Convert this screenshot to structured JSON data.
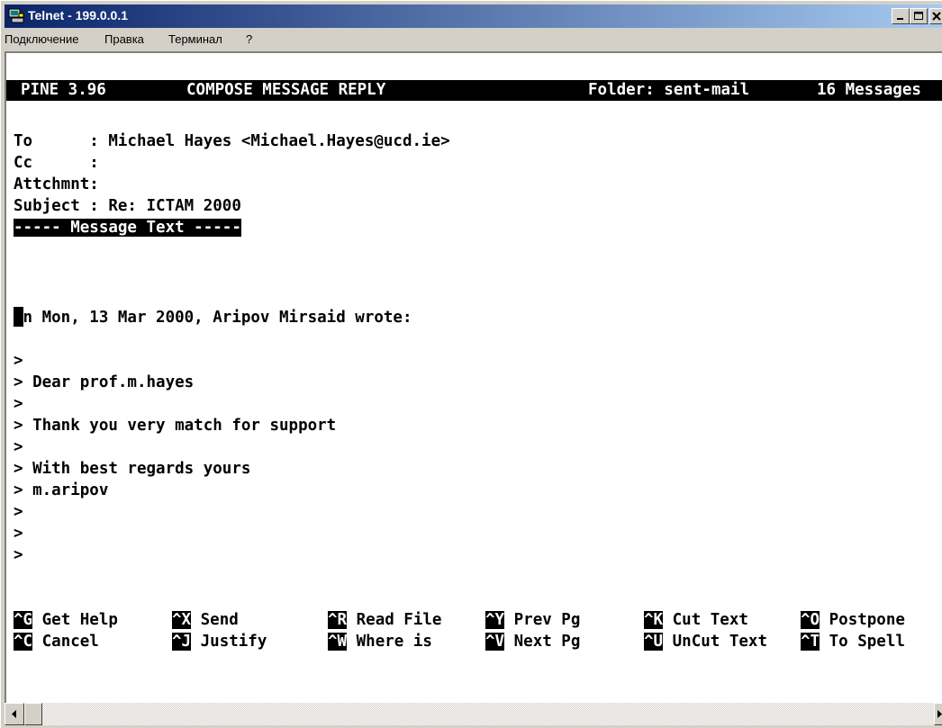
{
  "window": {
    "title": "Telnet - 199.0.0.1",
    "controls": [
      "minimize",
      "maximize",
      "close"
    ]
  },
  "menu": {
    "items": [
      "Подключение",
      "Правка",
      "Терминал",
      "?"
    ]
  },
  "status": {
    "program": "PINE 3.96",
    "mode": "COMPOSE MESSAGE REPLY",
    "folder": "Folder: sent-mail",
    "messages": "16 Messages"
  },
  "headers": [
    "To      : Michael Hayes <Michael.Hayes@ucd.ie>",
    "Cc      :",
    "Attchmnt:",
    "Subject : Re: ICTAM 2000"
  ],
  "separator": "----- Message Text -----",
  "body": {
    "attribution": "On Mon, 13 Mar 2000, Aripov Mirsaid wrote:",
    "quoted": [
      ">",
      "> Dear prof.m.hayes",
      ">",
      "> Thank you very match for support",
      ">",
      "> With best regards yours",
      "> m.aripov",
      ">",
      ">",
      ">"
    ]
  },
  "shortcuts": [
    [
      {
        "key": "^G",
        "label": "Get Help"
      },
      {
        "key": "^X",
        "label": "Send"
      },
      {
        "key": "^R",
        "label": "Read File"
      },
      {
        "key": "^Y",
        "label": "Prev Pg"
      },
      {
        "key": "^K",
        "label": "Cut Text"
      },
      {
        "key": "^O",
        "label": "Postpone"
      }
    ],
    [
      {
        "key": "^C",
        "label": "Cancel"
      },
      {
        "key": "^J",
        "label": "Justify"
      },
      {
        "key": "^W",
        "label": "Where is"
      },
      {
        "key": "^V",
        "label": "Next Pg"
      },
      {
        "key": "^U",
        "label": "UnCut Text"
      },
      {
        "key": "^T",
        "label": "To Spell"
      }
    ]
  ],
  "icons": {
    "app": "telnet-icon",
    "scroll_left": "arrow-left-icon",
    "scroll_right": "arrow-right-icon"
  }
}
